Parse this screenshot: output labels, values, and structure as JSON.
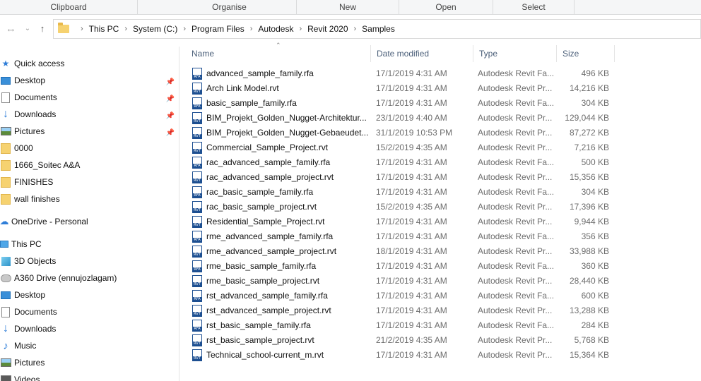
{
  "ribbon": {
    "groups": [
      "Clipboard",
      "Organise",
      "New",
      "Open",
      "Select"
    ]
  },
  "nav": {
    "back_icon": "back-arrow-icon",
    "forward_icon": "forward-arrow-icon",
    "recent_icon": "chevron-down-icon",
    "up_icon": "up-arrow-icon",
    "breadcrumb": [
      "This PC",
      "System (C:)",
      "Program Files",
      "Autodesk",
      "Revit 2020",
      "Samples"
    ]
  },
  "sidebar": {
    "items": [
      {
        "label": "Quick access",
        "icon": "star-icon",
        "pinned": false
      },
      {
        "label": "Desktop",
        "icon": "desktop-icon",
        "pinned": true
      },
      {
        "label": "Documents",
        "icon": "documents-icon",
        "pinned": true
      },
      {
        "label": "Downloads",
        "icon": "downloads-icon",
        "pinned": true
      },
      {
        "label": "Pictures",
        "icon": "pictures-icon",
        "pinned": true
      },
      {
        "label": "0000",
        "icon": "folder-icon",
        "pinned": false
      },
      {
        "label": "1666_Soitec A&A",
        "icon": "folder-icon",
        "pinned": false
      },
      {
        "label": "FINISHES",
        "icon": "folder-icon",
        "pinned": false
      },
      {
        "label": "wall finishes",
        "icon": "folder-icon",
        "pinned": false
      },
      {
        "label": "OneDrive - Personal",
        "icon": "cloud-icon",
        "pinned": false
      },
      {
        "label": "This PC",
        "icon": "computer-icon",
        "pinned": false
      },
      {
        "label": "3D Objects",
        "icon": "cube-icon",
        "pinned": false
      },
      {
        "label": "A360 Drive (ennujozlagam)",
        "icon": "drive-icon",
        "pinned": false
      },
      {
        "label": "Desktop",
        "icon": "desktop-icon",
        "pinned": false
      },
      {
        "label": "Documents",
        "icon": "documents-icon",
        "pinned": false
      },
      {
        "label": "Downloads",
        "icon": "downloads-icon",
        "pinned": false
      },
      {
        "label": "Music",
        "icon": "music-icon",
        "pinned": false
      },
      {
        "label": "Pictures",
        "icon": "pictures-icon",
        "pinned": false
      },
      {
        "label": "Videos",
        "icon": "videos-icon",
        "pinned": false
      }
    ]
  },
  "columns": {
    "name": "Name",
    "date": "Date modified",
    "type": "Type",
    "size": "Size"
  },
  "files": [
    {
      "name": "advanced_sample_family.rfa",
      "date": "17/1/2019 4:31 AM",
      "type": "Autodesk Revit Fa...",
      "size": "496 KB",
      "ext": "RFA"
    },
    {
      "name": "Arch Link Model.rvt",
      "date": "17/1/2019 4:31 AM",
      "type": "Autodesk Revit Pr...",
      "size": "14,216 KB",
      "ext": "RVT"
    },
    {
      "name": "basic_sample_family.rfa",
      "date": "17/1/2019 4:31 AM",
      "type": "Autodesk Revit Fa...",
      "size": "304 KB",
      "ext": "RFA"
    },
    {
      "name": "BIM_Projekt_Golden_Nugget-Architektur...",
      "date": "23/1/2019 4:40 AM",
      "type": "Autodesk Revit Pr...",
      "size": "129,044 KB",
      "ext": "RVT"
    },
    {
      "name": "BIM_Projekt_Golden_Nugget-Gebaeudet...",
      "date": "31/1/2019 10:53 PM",
      "type": "Autodesk Revit Pr...",
      "size": "87,272 KB",
      "ext": "RVT"
    },
    {
      "name": "Commercial_Sample_Project.rvt",
      "date": "15/2/2019 4:35 AM",
      "type": "Autodesk Revit Pr...",
      "size": "7,216 KB",
      "ext": "RVT"
    },
    {
      "name": "rac_advanced_sample_family.rfa",
      "date": "17/1/2019 4:31 AM",
      "type": "Autodesk Revit Fa...",
      "size": "500 KB",
      "ext": "RFA"
    },
    {
      "name": "rac_advanced_sample_project.rvt",
      "date": "17/1/2019 4:31 AM",
      "type": "Autodesk Revit Pr...",
      "size": "15,356 KB",
      "ext": "RVT"
    },
    {
      "name": "rac_basic_sample_family.rfa",
      "date": "17/1/2019 4:31 AM",
      "type": "Autodesk Revit Fa...",
      "size": "304 KB",
      "ext": "RFA"
    },
    {
      "name": "rac_basic_sample_project.rvt",
      "date": "15/2/2019 4:35 AM",
      "type": "Autodesk Revit Pr...",
      "size": "17,396 KB",
      "ext": "RVT"
    },
    {
      "name": "Residential_Sample_Project.rvt",
      "date": "17/1/2019 4:31 AM",
      "type": "Autodesk Revit Pr...",
      "size": "9,944 KB",
      "ext": "RVT"
    },
    {
      "name": "rme_advanced_sample_family.rfa",
      "date": "17/1/2019 4:31 AM",
      "type": "Autodesk Revit Fa...",
      "size": "356 KB",
      "ext": "RFA"
    },
    {
      "name": "rme_advanced_sample_project.rvt",
      "date": "18/1/2019 4:31 AM",
      "type": "Autodesk Revit Pr...",
      "size": "33,988 KB",
      "ext": "RVT"
    },
    {
      "name": "rme_basic_sample_family.rfa",
      "date": "17/1/2019 4:31 AM",
      "type": "Autodesk Revit Fa...",
      "size": "360 KB",
      "ext": "RFA"
    },
    {
      "name": "rme_basic_sample_project.rvt",
      "date": "17/1/2019 4:31 AM",
      "type": "Autodesk Revit Pr...",
      "size": "28,440 KB",
      "ext": "RVT"
    },
    {
      "name": "rst_advanced_sample_family.rfa",
      "date": "17/1/2019 4:31 AM",
      "type": "Autodesk Revit Fa...",
      "size": "600 KB",
      "ext": "RFA"
    },
    {
      "name": "rst_advanced_sample_project.rvt",
      "date": "17/1/2019 4:31 AM",
      "type": "Autodesk Revit Pr...",
      "size": "13,288 KB",
      "ext": "RVT"
    },
    {
      "name": "rst_basic_sample_family.rfa",
      "date": "17/1/2019 4:31 AM",
      "type": "Autodesk Revit Fa...",
      "size": "284 KB",
      "ext": "RFA"
    },
    {
      "name": "rst_basic_sample_project.rvt",
      "date": "21/2/2019 4:35 AM",
      "type": "Autodesk Revit Pr...",
      "size": "5,768 KB",
      "ext": "RVT"
    },
    {
      "name": "Technical_school-current_m.rvt",
      "date": "17/1/2019 4:31 AM",
      "type": "Autodesk Revit Pr...",
      "size": "15,364 KB",
      "ext": "RVT"
    }
  ]
}
